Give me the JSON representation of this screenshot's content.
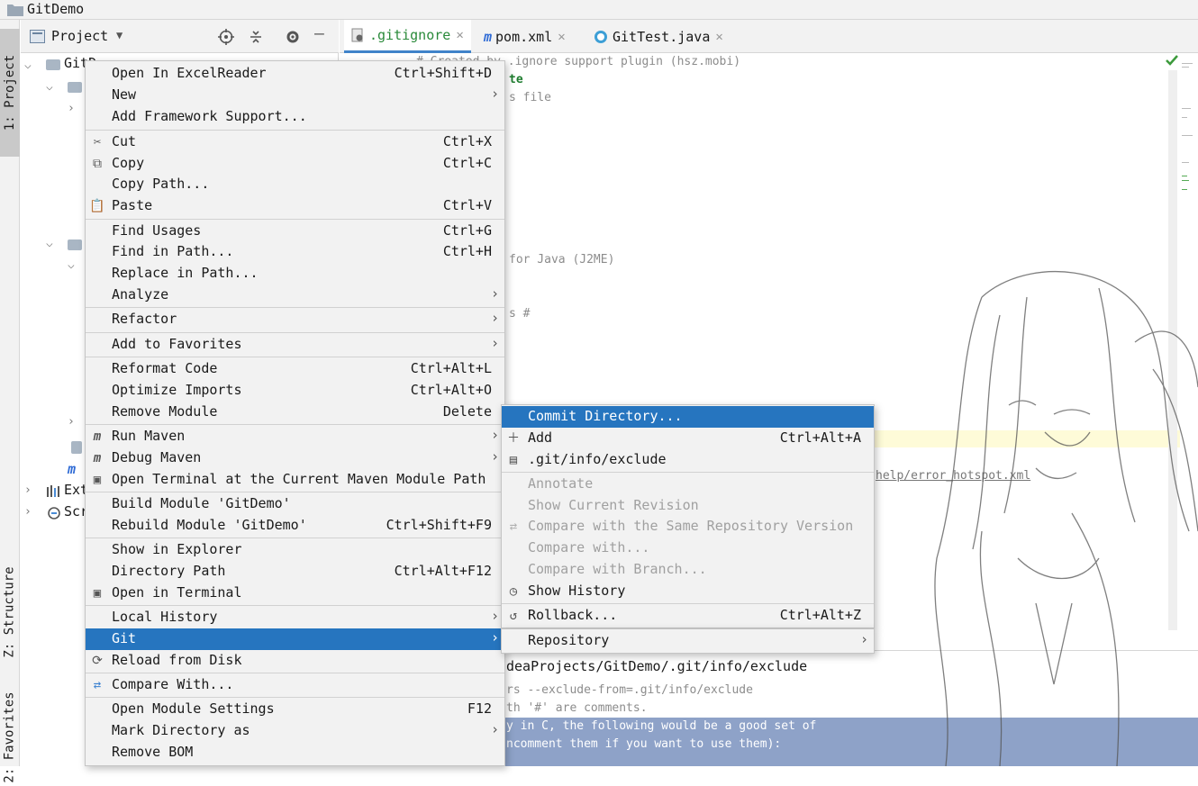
{
  "window": {
    "title": "GitDemo"
  },
  "toolstrip": {
    "project": "1: Project",
    "structure": "Z: Structure",
    "favorites": "2: Favorites"
  },
  "project_panel": {
    "title": "Project",
    "root": "GitD",
    "nodes": [
      "Ext",
      "Scr"
    ]
  },
  "editor_tabs": [
    {
      "label": ".gitignore",
      "active": true
    },
    {
      "label": "pom.xml",
      "active": false
    },
    {
      "label": "GitTest.java",
      "active": false
    }
  ],
  "editor_lines": [
    "# Created by .ignore support plugin (hsz.mobi)",
    "te",
    "s file",
    "for Java (J2ME)",
    "s #",
    "help/error_hotspot.xml"
  ],
  "bottom": {
    "path": "deaProjects/GitDemo/.git/info/exclude",
    "lines": [
      "rs --exclude-from=.git/info/exclude",
      "th '#' are comments.",
      "y in C, the following would be a good set of",
      "ncomment them if you want to use them):"
    ]
  },
  "context_menu": [
    {
      "label": "Open In ExcelReader",
      "shortcut": "Ctrl+Shift+D"
    },
    {
      "label": "New",
      "submenu": true
    },
    {
      "label": "Add Framework Support..."
    },
    {
      "label": "Cut",
      "shortcut": "Ctrl+X",
      "icon": "scissors-icon"
    },
    {
      "label": "Copy",
      "shortcut": "Ctrl+C",
      "icon": "copy-icon"
    },
    {
      "label": "Copy Path..."
    },
    {
      "label": "Paste",
      "shortcut": "Ctrl+V",
      "icon": "clipboard-icon"
    },
    {
      "label": "Find Usages",
      "shortcut": "Ctrl+G"
    },
    {
      "label": "Find in Path...",
      "shortcut": "Ctrl+H"
    },
    {
      "label": "Replace in Path..."
    },
    {
      "label": "Analyze",
      "submenu": true
    },
    {
      "label": "Refactor",
      "submenu": true
    },
    {
      "label": "Add to Favorites",
      "submenu": true
    },
    {
      "label": "Reformat Code",
      "shortcut": "Ctrl+Alt+L"
    },
    {
      "label": "Optimize Imports",
      "shortcut": "Ctrl+Alt+O"
    },
    {
      "label": "Remove Module",
      "shortcut": "Delete"
    },
    {
      "label": "Run Maven",
      "submenu": true,
      "icon": "maven-run-icon"
    },
    {
      "label": "Debug Maven",
      "submenu": true,
      "icon": "maven-debug-icon"
    },
    {
      "label": "Open Terminal at the Current Maven Module Path",
      "icon": "maven-terminal-icon"
    },
    {
      "label": "Build Module 'GitDemo'"
    },
    {
      "label": "Rebuild Module 'GitDemo'",
      "shortcut": "Ctrl+Shift+F9"
    },
    {
      "label": "Show in Explorer"
    },
    {
      "label": "Directory Path",
      "shortcut": "Ctrl+Alt+F12"
    },
    {
      "label": "Open in Terminal",
      "icon": "terminal-icon"
    },
    {
      "label": "Local History",
      "submenu": true
    },
    {
      "label": "Git",
      "submenu": true,
      "selected": true
    },
    {
      "label": "Reload from Disk",
      "icon": "reload-icon"
    },
    {
      "label": "Compare With...",
      "icon": "compare-icon"
    },
    {
      "label": "Open Module Settings",
      "shortcut": "F12"
    },
    {
      "label": "Mark Directory as",
      "submenu": true
    },
    {
      "label": "Remove BOM"
    }
  ],
  "git_submenu": [
    {
      "label": "Commit Directory...",
      "selected": true
    },
    {
      "label": "Add",
      "shortcut": "Ctrl+Alt+A",
      "icon": "plus-icon"
    },
    {
      "label": ".git/info/exclude",
      "icon": "exclude-file-icon"
    },
    {
      "label": "Annotate",
      "disabled": true
    },
    {
      "label": "Show Current Revision",
      "disabled": true
    },
    {
      "label": "Compare with the Same Repository Version",
      "disabled": true,
      "icon": "compare-icon"
    },
    {
      "label": "Compare with...",
      "disabled": true
    },
    {
      "label": "Compare with Branch...",
      "disabled": true
    },
    {
      "label": "Show History",
      "icon": "clock-icon"
    },
    {
      "label": "Rollback...",
      "shortcut": "Ctrl+Alt+Z",
      "icon": "rollback-icon"
    },
    {
      "label": "Repository",
      "submenu": true
    }
  ],
  "colors": {
    "selection": "#2675bf",
    "menu_bg": "#f2f2f2",
    "tab_accent": "#4083c9"
  }
}
